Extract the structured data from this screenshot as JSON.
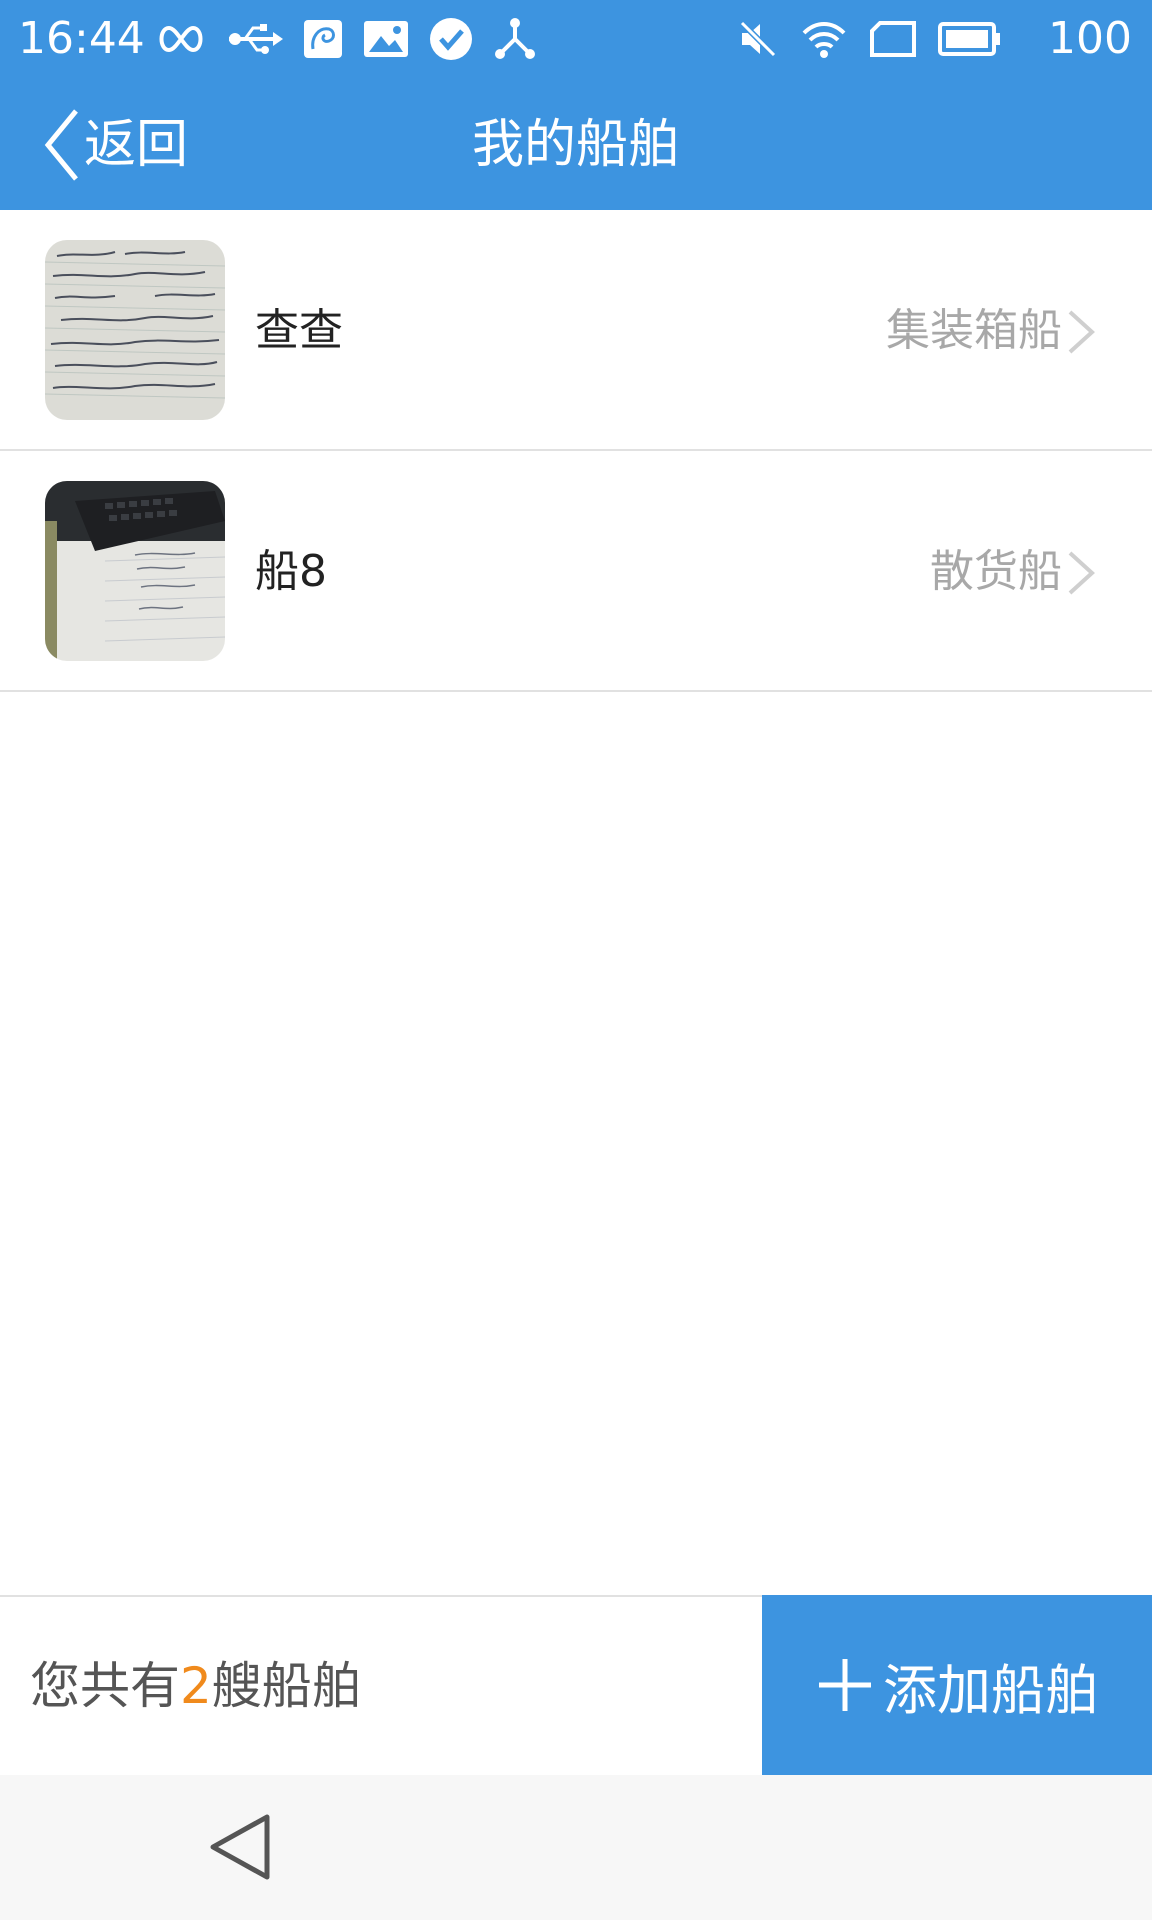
{
  "status_bar": {
    "time": "16:44",
    "battery_level": "100",
    "left_icons": [
      "infinity-icon",
      "usb-icon",
      "app-notification-icon",
      "image-icon",
      "check-circle-icon",
      "share-nodes-icon"
    ],
    "right_icons": [
      "mute-icon",
      "wifi-icon",
      "sim-card-icon",
      "battery-icon"
    ]
  },
  "nav": {
    "back_label": "返回",
    "title": "我的船舶"
  },
  "ships": [
    {
      "name": "查查",
      "type": "集装箱船"
    },
    {
      "name": "船8",
      "type": "散货船"
    }
  ],
  "footer": {
    "count_prefix": "您共有",
    "count": "2",
    "count_suffix": "艘船舶",
    "add_label": "添加船舶"
  },
  "colors": {
    "primary": "#3d94e0",
    "accent": "#f08a1c",
    "muted_text": "#a8a8a8"
  }
}
